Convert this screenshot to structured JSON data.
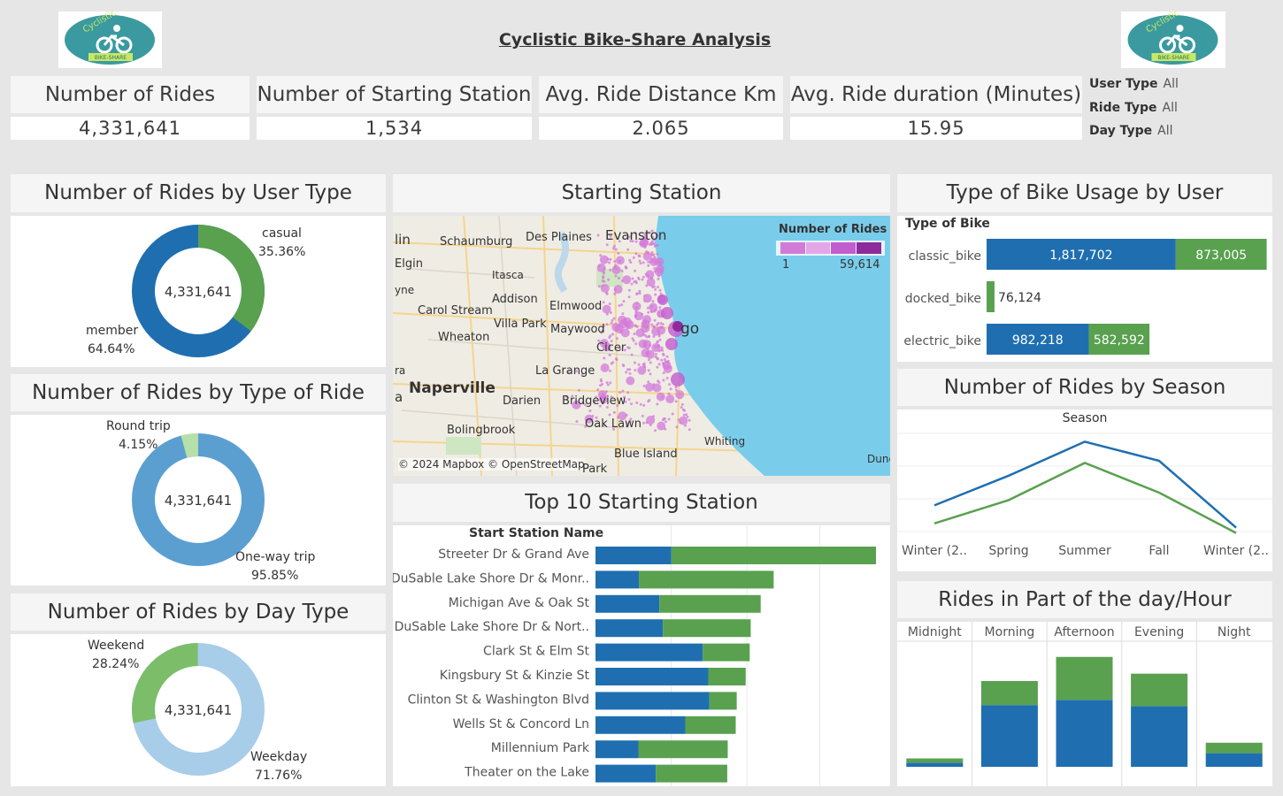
{
  "header": {
    "title": "Cyclistic Bike-Share Analysis",
    "logo_text": "Cyclistic",
    "logo_sub": "BIKE-SHARE"
  },
  "kpis": [
    {
      "label": "Number of Rides",
      "value": "4,331,641"
    },
    {
      "label": "Number of Starting Station",
      "value": "1,534"
    },
    {
      "label": "Avg. Ride Distance Km",
      "value": "2.065"
    },
    {
      "label": "Avg. Ride duration (Minutes)",
      "value": "15.95"
    }
  ],
  "filters": [
    {
      "label": "User Type",
      "value": "All"
    },
    {
      "label": "Ride Type",
      "value": "All"
    },
    {
      "label": "Day Type",
      "value": "All"
    }
  ],
  "colors": {
    "blue": "#1f6fb0",
    "green": "#59a14f",
    "lightgreen": "#b7dfa9",
    "midblue": "#5b9fd1",
    "lightblue": "#a7cde9",
    "mgreen": "#7cbd6a",
    "map_water": "#79cdeb",
    "map_pin": "#d37ad9"
  },
  "user_type": {
    "title": "Number of Rides by User Type",
    "center": "4,331,641",
    "slices": [
      {
        "name": "casual",
        "pct": "35.36%",
        "value": 35.36
      },
      {
        "name": "member",
        "pct": "64.64%",
        "value": 64.64
      }
    ]
  },
  "ride_type": {
    "title": "Number of Rides by Type of Ride",
    "center": "4,331,641",
    "slices": [
      {
        "name": "Round trip",
        "pct": "4.15%",
        "value": 4.15
      },
      {
        "name": "One-way trip",
        "pct": "95.85%",
        "value": 95.85
      }
    ]
  },
  "day_type": {
    "title": "Number of Rides by Day Type",
    "center": "4,331,641",
    "slices": [
      {
        "name": "Weekday",
        "pct": "71.76%",
        "value": 71.76
      },
      {
        "name": "Weekend",
        "pct": "28.24%",
        "value": 28.24
      }
    ]
  },
  "map": {
    "title": "Starting Station",
    "legend_title": "Number of Rides",
    "legend_min": "1",
    "legend_max": "59,614",
    "attribution": "© 2024 Mapbox © OpenStreetMap",
    "places": [
      "lin",
      "Schaumburg",
      "Des Plaines",
      "Evanston",
      "Elgin",
      "Itasca",
      "yne",
      "Addison",
      "Elmwood",
      "Carol Stream",
      "Villa Park",
      "Maywood",
      "Wheaton",
      "Cicer",
      "ra",
      "La Grange",
      "Naperville",
      "a",
      "Darien",
      "Bridgeview",
      "Bolingbrook",
      "Oak Lawn",
      "Whiting",
      "Blue Island",
      "Park",
      "Dune",
      "go"
    ]
  },
  "top10": {
    "title": "Top 10 Starting Station",
    "header": "Start Station Name",
    "chart_data": {
      "type": "bar",
      "categories": [
        "Streeter Dr & Grand Ave",
        "DuSable Lake Shore Dr & Monr..",
        "Michigan Ave & Oak St",
        "DuSable Lake Shore Dr & Nort..",
        "Clark St & Elm St",
        "Kingsbury St & Kinzie St",
        "Clinton St & Washington Blvd",
        "Wells St & Concord Ln",
        "Millennium Park",
        "Theater on the Lake"
      ],
      "series": [
        {
          "values": [
            15200,
            8700,
            12800,
            13500,
            21500,
            22600,
            22800,
            18000,
            8600,
            12100
          ]
        },
        {
          "values": [
            41000,
            27000,
            20300,
            17600,
            9400,
            7500,
            5500,
            10100,
            17900,
            14300
          ]
        }
      ],
      "xlim": [
        0,
        56200
      ]
    }
  },
  "bike_usage": {
    "title": "Type of Bike Usage by User",
    "header": "Type of Bike",
    "chart_data": {
      "type": "bar",
      "categories": [
        "classic_bike",
        "docked_bike",
        "electric_bike"
      ],
      "series": [
        {
          "values": [
            1817702,
            0,
            982218
          ],
          "labels": [
            "1,817,702",
            "",
            "982,218"
          ]
        },
        {
          "values": [
            873005,
            76124,
            582592
          ],
          "labels": [
            "873,005",
            "76,124",
            "582,592"
          ]
        }
      ]
    }
  },
  "season": {
    "title": "Number of Rides by Season",
    "header": "Season",
    "chart_data": {
      "type": "line",
      "categories": [
        "Winter (2..",
        "Spring",
        "Summer",
        "Fall",
        "Winter (2.."
      ],
      "series": [
        {
          "values": [
            280000,
            560000,
            880000,
            700000,
            70000
          ]
        },
        {
          "values": [
            110000,
            330000,
            680000,
            400000,
            20000
          ]
        }
      ],
      "ylim": [
        0,
        1000000
      ]
    }
  },
  "hourly": {
    "title": "Rides in Part of the day/Hour",
    "chart_data": {
      "type": "bar",
      "categories": [
        "Midnight",
        "Morning",
        "Afternoon",
        "Evening",
        "Night"
      ],
      "series": [
        {
          "values": [
            40000,
            590000,
            640000,
            580000,
            130000
          ]
        },
        {
          "values": [
            40000,
            230000,
            410000,
            310000,
            100000
          ]
        }
      ],
      "ylim": [
        0,
        1200000
      ]
    }
  }
}
